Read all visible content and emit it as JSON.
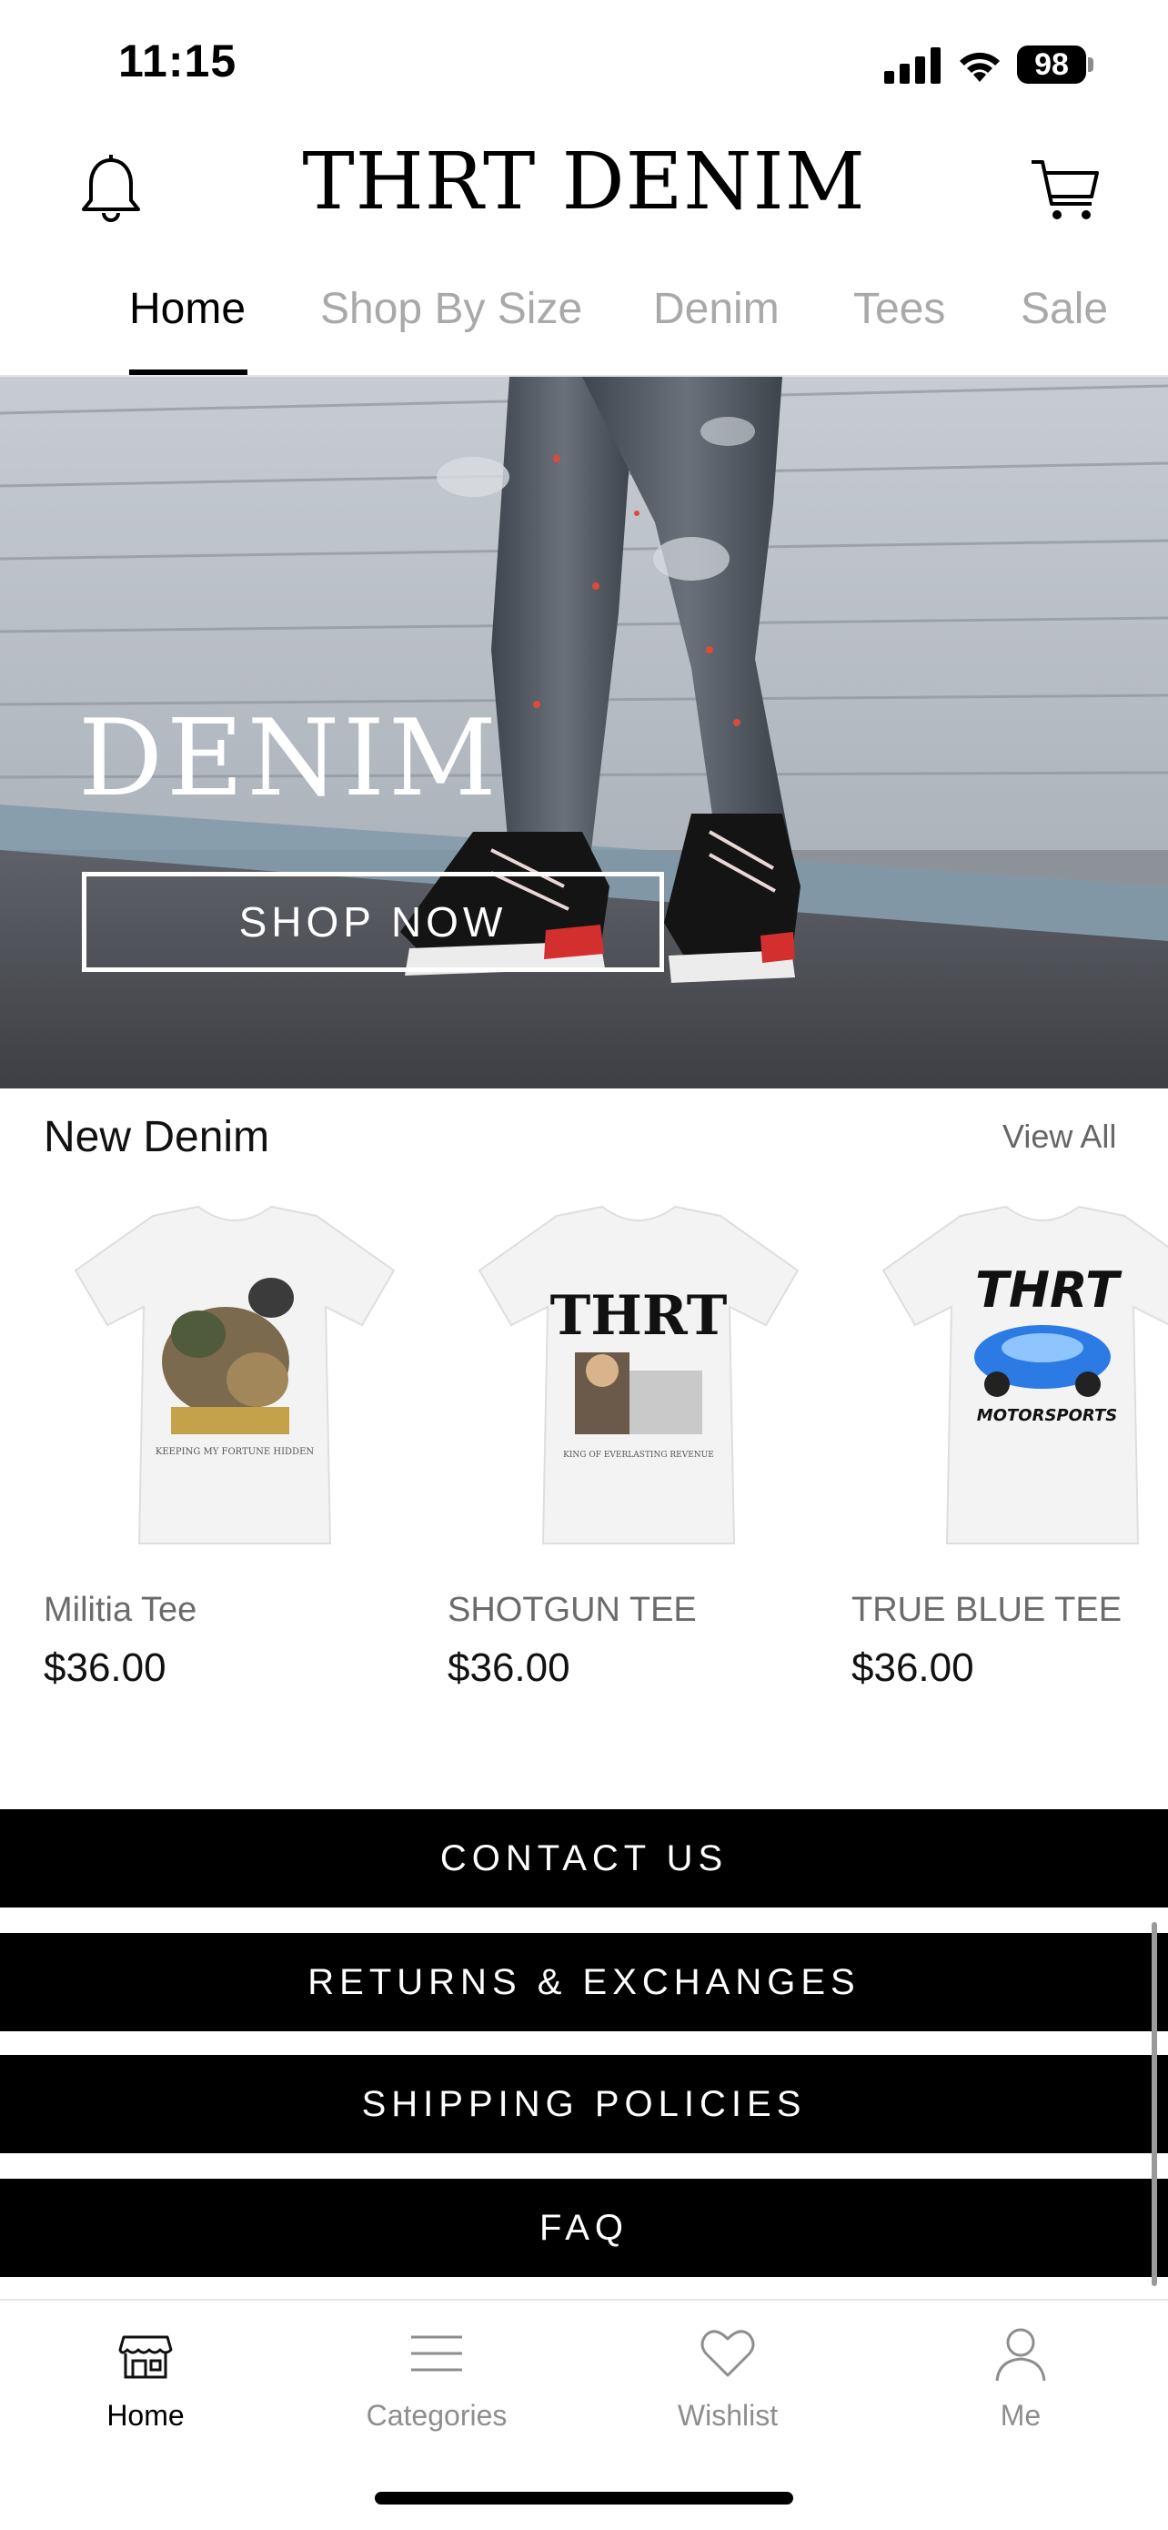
{
  "status_bar": {
    "time": "11:15",
    "battery": "98"
  },
  "header": {
    "brand": "THRT DENIM"
  },
  "tabs": [
    {
      "label": "Home"
    },
    {
      "label": "Shop By Size"
    },
    {
      "label": "Denim"
    },
    {
      "label": "Tees"
    },
    {
      "label": "Sale"
    }
  ],
  "hero": {
    "title": "DENIM",
    "cta": "SHOP NOW"
  },
  "section": {
    "title": "New Denim",
    "view_all": "View All",
    "products": [
      {
        "name": "Militia Tee",
        "price": "$36.00"
      },
      {
        "name": "SHOTGUN TEE",
        "price": "$36.00"
      },
      {
        "name": "TRUE BLUE TEE",
        "price": "$36.00"
      }
    ]
  },
  "footer_buttons": [
    {
      "label": "CONTACT US"
    },
    {
      "label": "RETURNS & EXCHANGES"
    },
    {
      "label": "SHIPPING POLICIES"
    },
    {
      "label": "FAQ"
    }
  ],
  "tab_bar": [
    {
      "label": "Home",
      "icon": "store-icon"
    },
    {
      "label": "Categories",
      "icon": "menu-lines-icon"
    },
    {
      "label": "Wishlist",
      "icon": "heart-icon"
    },
    {
      "label": "Me",
      "icon": "person-icon"
    }
  ],
  "colors": {
    "accent": "#000000",
    "inactive": "#a9a9a9",
    "background": "#ffffff"
  }
}
